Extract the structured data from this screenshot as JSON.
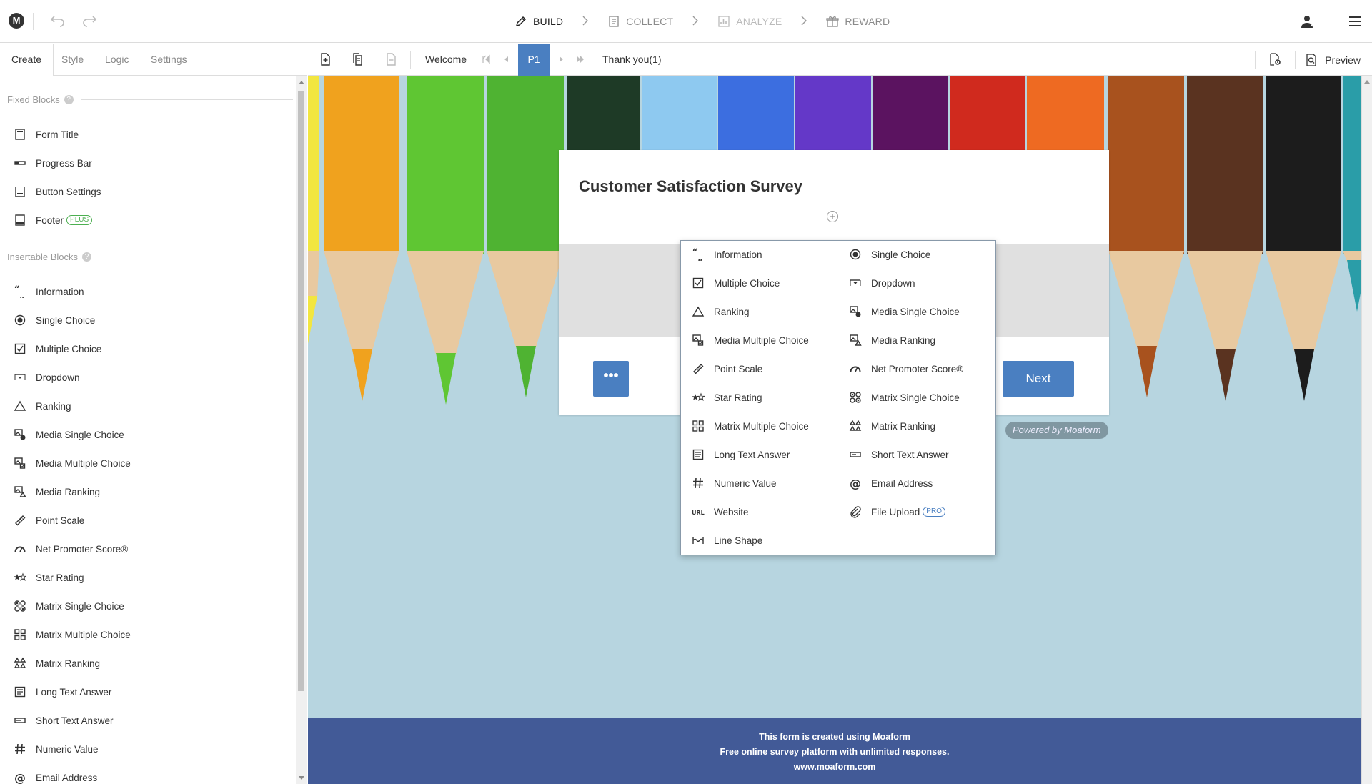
{
  "topbar": {
    "logo_letter": "M",
    "steps": [
      {
        "label": "BUILD",
        "icon": "pencil-icon",
        "state": "active"
      },
      {
        "label": "COLLECT",
        "icon": "document-icon",
        "state": "inactive"
      },
      {
        "label": "ANALYZE",
        "icon": "chart-icon",
        "state": "disabled"
      },
      {
        "label": "REWARD",
        "icon": "gift-icon",
        "state": "inactive"
      }
    ]
  },
  "sidebar": {
    "tabs": [
      "Create",
      "Style",
      "Logic",
      "Settings"
    ],
    "active_tab": "Create",
    "fixed_title": "Fixed Blocks",
    "fixed_items": [
      {
        "label": "Form Title",
        "icon": "form-title-icon"
      },
      {
        "label": "Progress Bar",
        "icon": "progress-bar-icon"
      },
      {
        "label": "Button Settings",
        "icon": "button-settings-icon"
      },
      {
        "label": "Footer",
        "icon": "footer-icon",
        "badge": "PLUS"
      }
    ],
    "insertable_title": "Insertable Blocks",
    "insertable_items": [
      {
        "label": "Information",
        "icon": "quote-icon"
      },
      {
        "label": "Single Choice",
        "icon": "radio-icon"
      },
      {
        "label": "Multiple Choice",
        "icon": "checkbox-icon"
      },
      {
        "label": "Dropdown",
        "icon": "dropdown-icon"
      },
      {
        "label": "Ranking",
        "icon": "triangle-icon"
      },
      {
        "label": "Media Single Choice",
        "icon": "media-single-icon"
      },
      {
        "label": "Media Multiple Choice",
        "icon": "media-multiple-icon"
      },
      {
        "label": "Media Ranking",
        "icon": "media-ranking-icon"
      },
      {
        "label": "Point Scale",
        "icon": "ruler-icon"
      },
      {
        "label": "Net Promoter Score®",
        "icon": "gauge-icon"
      },
      {
        "label": "Star Rating",
        "icon": "star-icon"
      },
      {
        "label": "Matrix Single Choice",
        "icon": "matrix-single-icon"
      },
      {
        "label": "Matrix Multiple Choice",
        "icon": "matrix-multiple-icon"
      },
      {
        "label": "Matrix Ranking",
        "icon": "matrix-ranking-icon"
      },
      {
        "label": "Long Text Answer",
        "icon": "long-text-icon"
      },
      {
        "label": "Short Text Answer",
        "icon": "short-text-icon"
      },
      {
        "label": "Numeric Value",
        "icon": "hash-icon"
      },
      {
        "label": "Email Address",
        "icon": "at-icon"
      }
    ]
  },
  "pagebar": {
    "welcome": "Welcome",
    "current_page": "P1",
    "thank_you": "Thank you(1)",
    "preview": "Preview"
  },
  "form": {
    "title": "Customer Satisfaction Survey",
    "more_label": "•••",
    "next_label": "Next",
    "powered_by": "Powered by Moaform"
  },
  "footer": {
    "line1": "This form is created using Moaform",
    "line2": "Free online survey platform with unlimited responses.",
    "line3": "www.moaform.com"
  },
  "block_menu": {
    "left": [
      {
        "label": "Information",
        "icon": "quote-icon"
      },
      {
        "label": "Multiple Choice",
        "icon": "checkbox-icon"
      },
      {
        "label": "Ranking",
        "icon": "triangle-icon"
      },
      {
        "label": "Media Multiple Choice",
        "icon": "media-multiple-icon"
      },
      {
        "label": "Point Scale",
        "icon": "ruler-icon"
      },
      {
        "label": "Star Rating",
        "icon": "star-icon"
      },
      {
        "label": "Matrix Multiple Choice",
        "icon": "matrix-multiple-icon"
      },
      {
        "label": "Long Text Answer",
        "icon": "long-text-icon"
      },
      {
        "label": "Numeric Value",
        "icon": "hash-icon"
      },
      {
        "label": "Website",
        "icon": "url-icon"
      },
      {
        "label": "Line Shape",
        "icon": "line-shape-icon"
      }
    ],
    "right": [
      {
        "label": "Single Choice",
        "icon": "radio-icon"
      },
      {
        "label": "Dropdown",
        "icon": "dropdown-icon"
      },
      {
        "label": "Media Single Choice",
        "icon": "media-single-icon"
      },
      {
        "label": "Media Ranking",
        "icon": "media-ranking-icon"
      },
      {
        "label": "Net Promoter Score®",
        "icon": "gauge-icon"
      },
      {
        "label": "Matrix Single Choice",
        "icon": "matrix-single-icon"
      },
      {
        "label": "Matrix Ranking",
        "icon": "matrix-ranking-icon"
      },
      {
        "label": "Short Text Answer",
        "icon": "short-text-icon"
      },
      {
        "label": "Email Address",
        "icon": "at-icon"
      },
      {
        "label": "File Upload",
        "icon": "paperclip-icon",
        "badge": "PRO"
      }
    ]
  },
  "colors": {
    "accent": "#4a7fc1",
    "footer_bg": "#425a97",
    "canvas_bg": "#b7d5e0"
  }
}
